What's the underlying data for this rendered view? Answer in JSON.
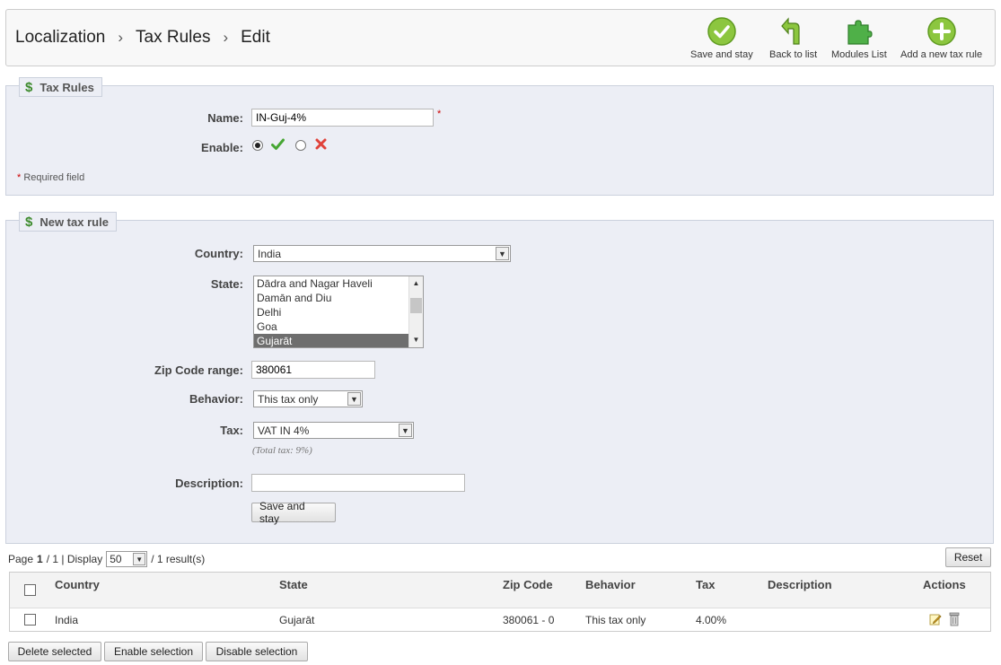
{
  "breadcrumb": [
    "Localization",
    "Tax Rules",
    "Edit"
  ],
  "toolbar": {
    "save_stay": "Save and stay",
    "back": "Back to list",
    "modules": "Modules List",
    "add_new": "Add a new tax rule"
  },
  "tax_rules_panel": {
    "legend": "Tax Rules",
    "name_label": "Name:",
    "name_value": "IN-Guj-4%",
    "required_star": "*",
    "enable_label": "Enable:",
    "required_note_star": "*",
    "required_note": "Required field"
  },
  "new_rule_panel": {
    "legend": "New tax rule",
    "country_label": "Country:",
    "country_value": "India",
    "state_label": "State:",
    "state_options": [
      "Dādra and Nagar Haveli",
      "Damān and Diu",
      "Delhi",
      "Goa",
      "Gujarāt"
    ],
    "zip_label": "Zip Code range:",
    "zip_value": "380061",
    "behavior_label": "Behavior:",
    "behavior_value": "This tax only",
    "tax_label": "Tax:",
    "tax_value": "VAT IN 4%",
    "total_tax": "(Total tax: 9%)",
    "description_label": "Description:",
    "description_value": "",
    "save_button": "Save and stay"
  },
  "pagination": {
    "page_prefix": "Page",
    "page_current": "1",
    "page_rest": "/ 1 | Display",
    "per_page": "50",
    "results": "/ 1 result(s)",
    "reset": "Reset"
  },
  "table": {
    "headers": [
      "Country",
      "State",
      "Zip Code",
      "Behavior",
      "Tax",
      "Description",
      "Actions"
    ],
    "rows": [
      {
        "country": "India",
        "state": "Gujarāt",
        "zip": "380061 - 0",
        "behavior": "This tax only",
        "tax": "4.00%",
        "description": ""
      }
    ]
  },
  "bulk_actions": {
    "delete": "Delete selected",
    "enable": "Enable selection",
    "disable": "Disable selection"
  },
  "colors": {
    "panel_bg": "#eceef5",
    "accent_green": "#8cc63f",
    "required_red": "#cc0000"
  }
}
